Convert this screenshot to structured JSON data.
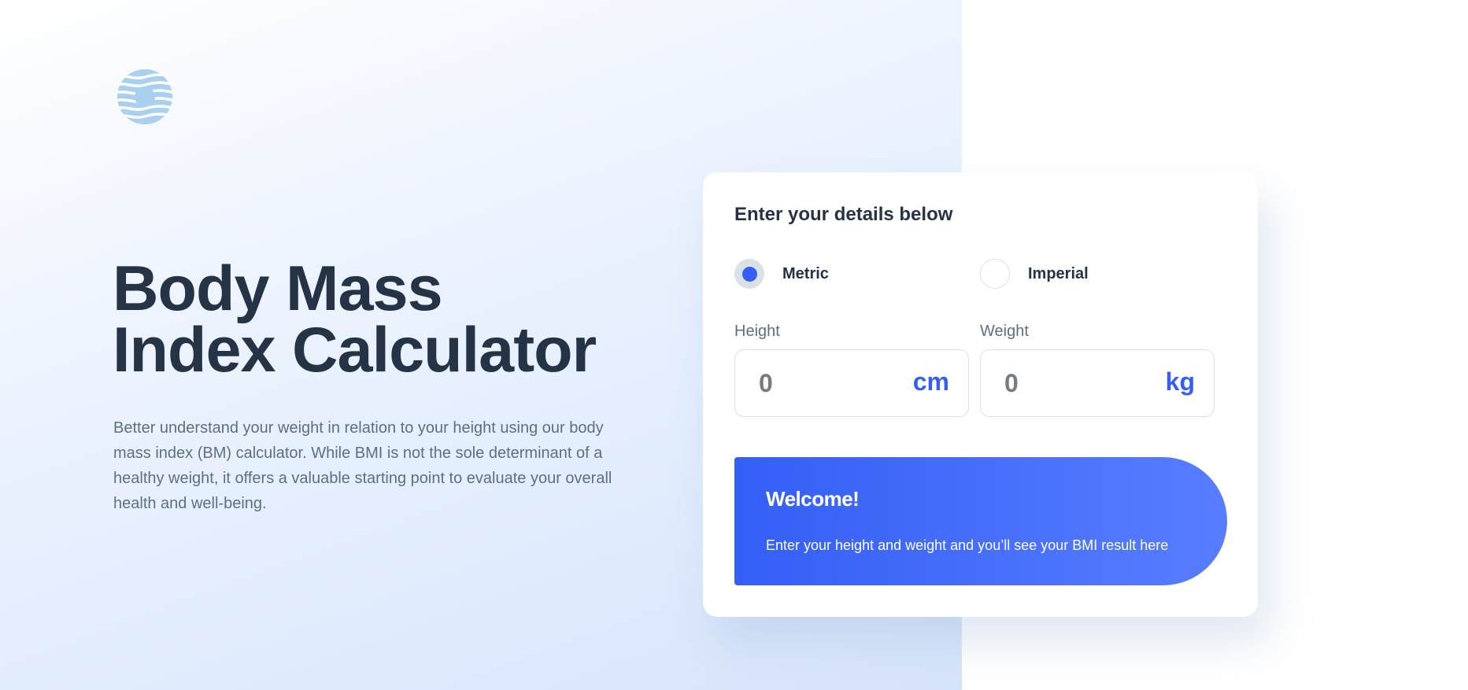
{
  "logo": {
    "icon": "bmi-logo-icon",
    "color": "#a9d0ee"
  },
  "hero": {
    "title_line1": "Body Mass",
    "title_line2": "Index Calculator",
    "intro": "Better understand your weight in relation to your height using our body mass index (BM) calculator. While BMI is not the sole determinant of a healthy weight, it offers a valuable starting point to evaluate your overall health and well-being."
  },
  "calculator": {
    "heading": "Enter your details below",
    "units": {
      "metric_label": "Metric",
      "imperial_label": "Imperial",
      "selected": "Metric"
    },
    "height": {
      "label": "Height",
      "placeholder": "0",
      "value": "",
      "unit": "cm"
    },
    "weight": {
      "label": "Weight",
      "placeholder": "0",
      "value": "",
      "unit": "kg"
    },
    "result": {
      "title": "Welcome!",
      "message": "Enter your height and weight and you’ll see your BMI result here"
    }
  },
  "colors": {
    "accent": "#345ff6",
    "heading": "#253347",
    "body_text": "#5e6e85",
    "border": "#d8e2e7"
  }
}
